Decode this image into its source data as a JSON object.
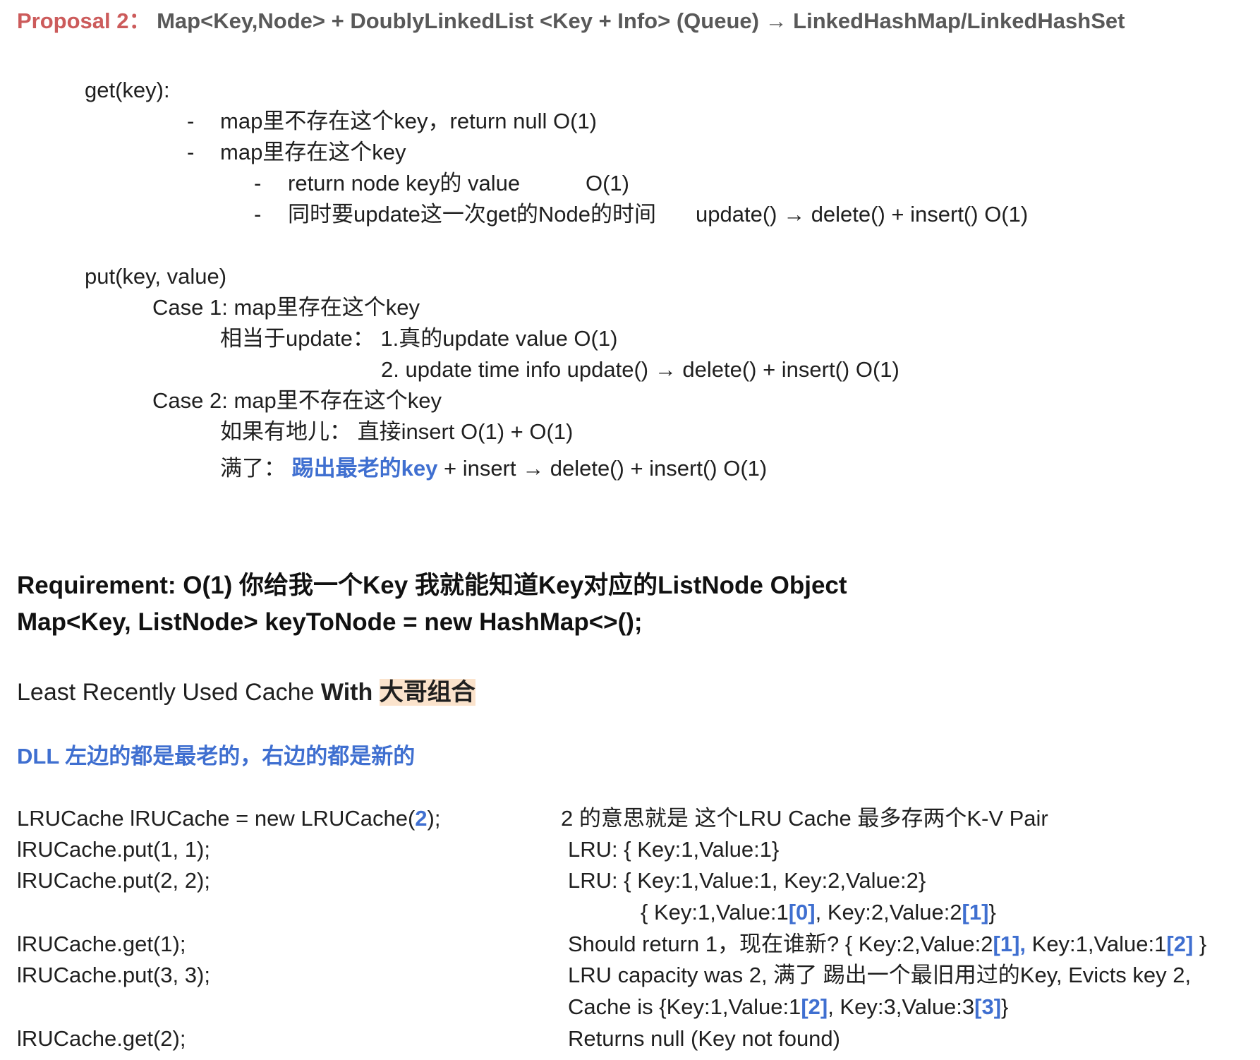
{
  "header": {
    "label": "Proposal 2：",
    "text": " Map<Key,Node> + DoublyLinkedList <Key + Info>  (Queue)  → LinkedHashMap/LinkedHashSet"
  },
  "get_section": {
    "heading": "get(key):",
    "bullet1": "map里不存在这个key，return null   O(1)",
    "bullet2": "map里存在这个key",
    "sub1_a": "return node key的 value",
    "sub1_b": "O(1)",
    "sub2_a": "同时要update这一次get的Node的时间",
    "sub2_b": "update() → delete() + insert()  O(1)",
    "dash": "-"
  },
  "put_section": {
    "heading": "put(key, value)",
    "case1": "Case 1: map里存在这个key",
    "case1_line1": "相当于update：  1.真的update value     O(1)",
    "case1_line2": "2. update time info  update() → delete() + insert()  O(1)",
    "case2": "Case 2: map里不存在这个key",
    "case2_line1": "如果有地儿： 直接insert  O(1) + O(1)",
    "case2_full_prefix": "满了： ",
    "case2_full_blue": "踢出最老的key",
    "case2_full_suffix": " + insert → delete() + insert()   O(1)"
  },
  "requirement": {
    "line1": "Requirement: O(1) 你给我一个Key 我就能知道Key对应的ListNode Object",
    "line2": "Map<Key, ListNode> keyToNode = new HashMap<>();"
  },
  "lru_title": {
    "plain": "Least Recently Used Cache ",
    "bold": "With ",
    "highlight": "大哥组合"
  },
  "dll_note": "DLL 左边的都是最老的，右边的都是新的",
  "code": {
    "c1_prefix": "LRUCache lRUCache = new LRUCache(",
    "c1_num": "2",
    "c1_suffix": ");",
    "c2": "lRUCache.put(1, 1);",
    "c3": "lRUCache.put(2, 2);",
    "c4": "lRUCache.get(1);",
    "c5": "lRUCache.put(3, 3);",
    "c6": "lRUCache.get(2);"
  },
  "notes": {
    "n1": "2 的意思就是 这个LRU Cache 最多存两个K-V Pair",
    "n2": "LRU:   { Key:1,Value:1}",
    "n3": "LRU:   { Key:1,Value:1, Key:2,Value:2}",
    "n4_a": "{ Key:1,Value:1",
    "n4_b": "[0]",
    "n4_c": ", Key:2,Value:2",
    "n4_d": "[1]",
    "n4_e": "}",
    "n5_a": "Should return 1，现在谁新?  { Key:2,Value:2",
    "n5_b": "[1],",
    "n5_c": "   Key:1,Value:1",
    "n5_d": "[2]",
    "n5_e": " }",
    "n6": "LRU capacity was 2, 满了  踢出一个最旧用过的Key, Evicts key 2,",
    "n7_a": "Cache is {Key:1,Value:1",
    "n7_b": "[2]",
    "n7_c": ", Key:3,Value:3",
    "n7_d": "[3]",
    "n7_e": "}",
    "n8": "Returns null (Key not found)"
  },
  "colors": {
    "accent_red": "#cc5b5b",
    "accent_blue": "#3f6fd0",
    "highlight_bg": "#fbe3cc",
    "title_gray": "#595959"
  }
}
